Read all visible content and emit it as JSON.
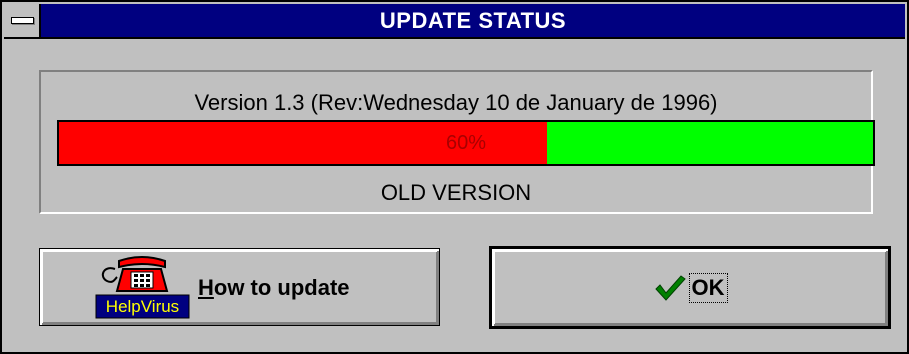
{
  "window": {
    "title": "UPDATE STATUS"
  },
  "status_panel": {
    "version_text": "Version 1.3 (Rev:Wednesday 10 de January de 1996)",
    "progress_label": "60%",
    "progress_value": 0.6,
    "status_text": "OLD VERSION",
    "colors": {
      "fill": "#ff0000",
      "remaining": "#00ff00",
      "label": "#a80000"
    }
  },
  "buttons": {
    "help": {
      "icon_text": "HelpVirus",
      "label_prefix": "H",
      "label_rest": "ow to update"
    },
    "ok": {
      "label": "OK"
    }
  }
}
